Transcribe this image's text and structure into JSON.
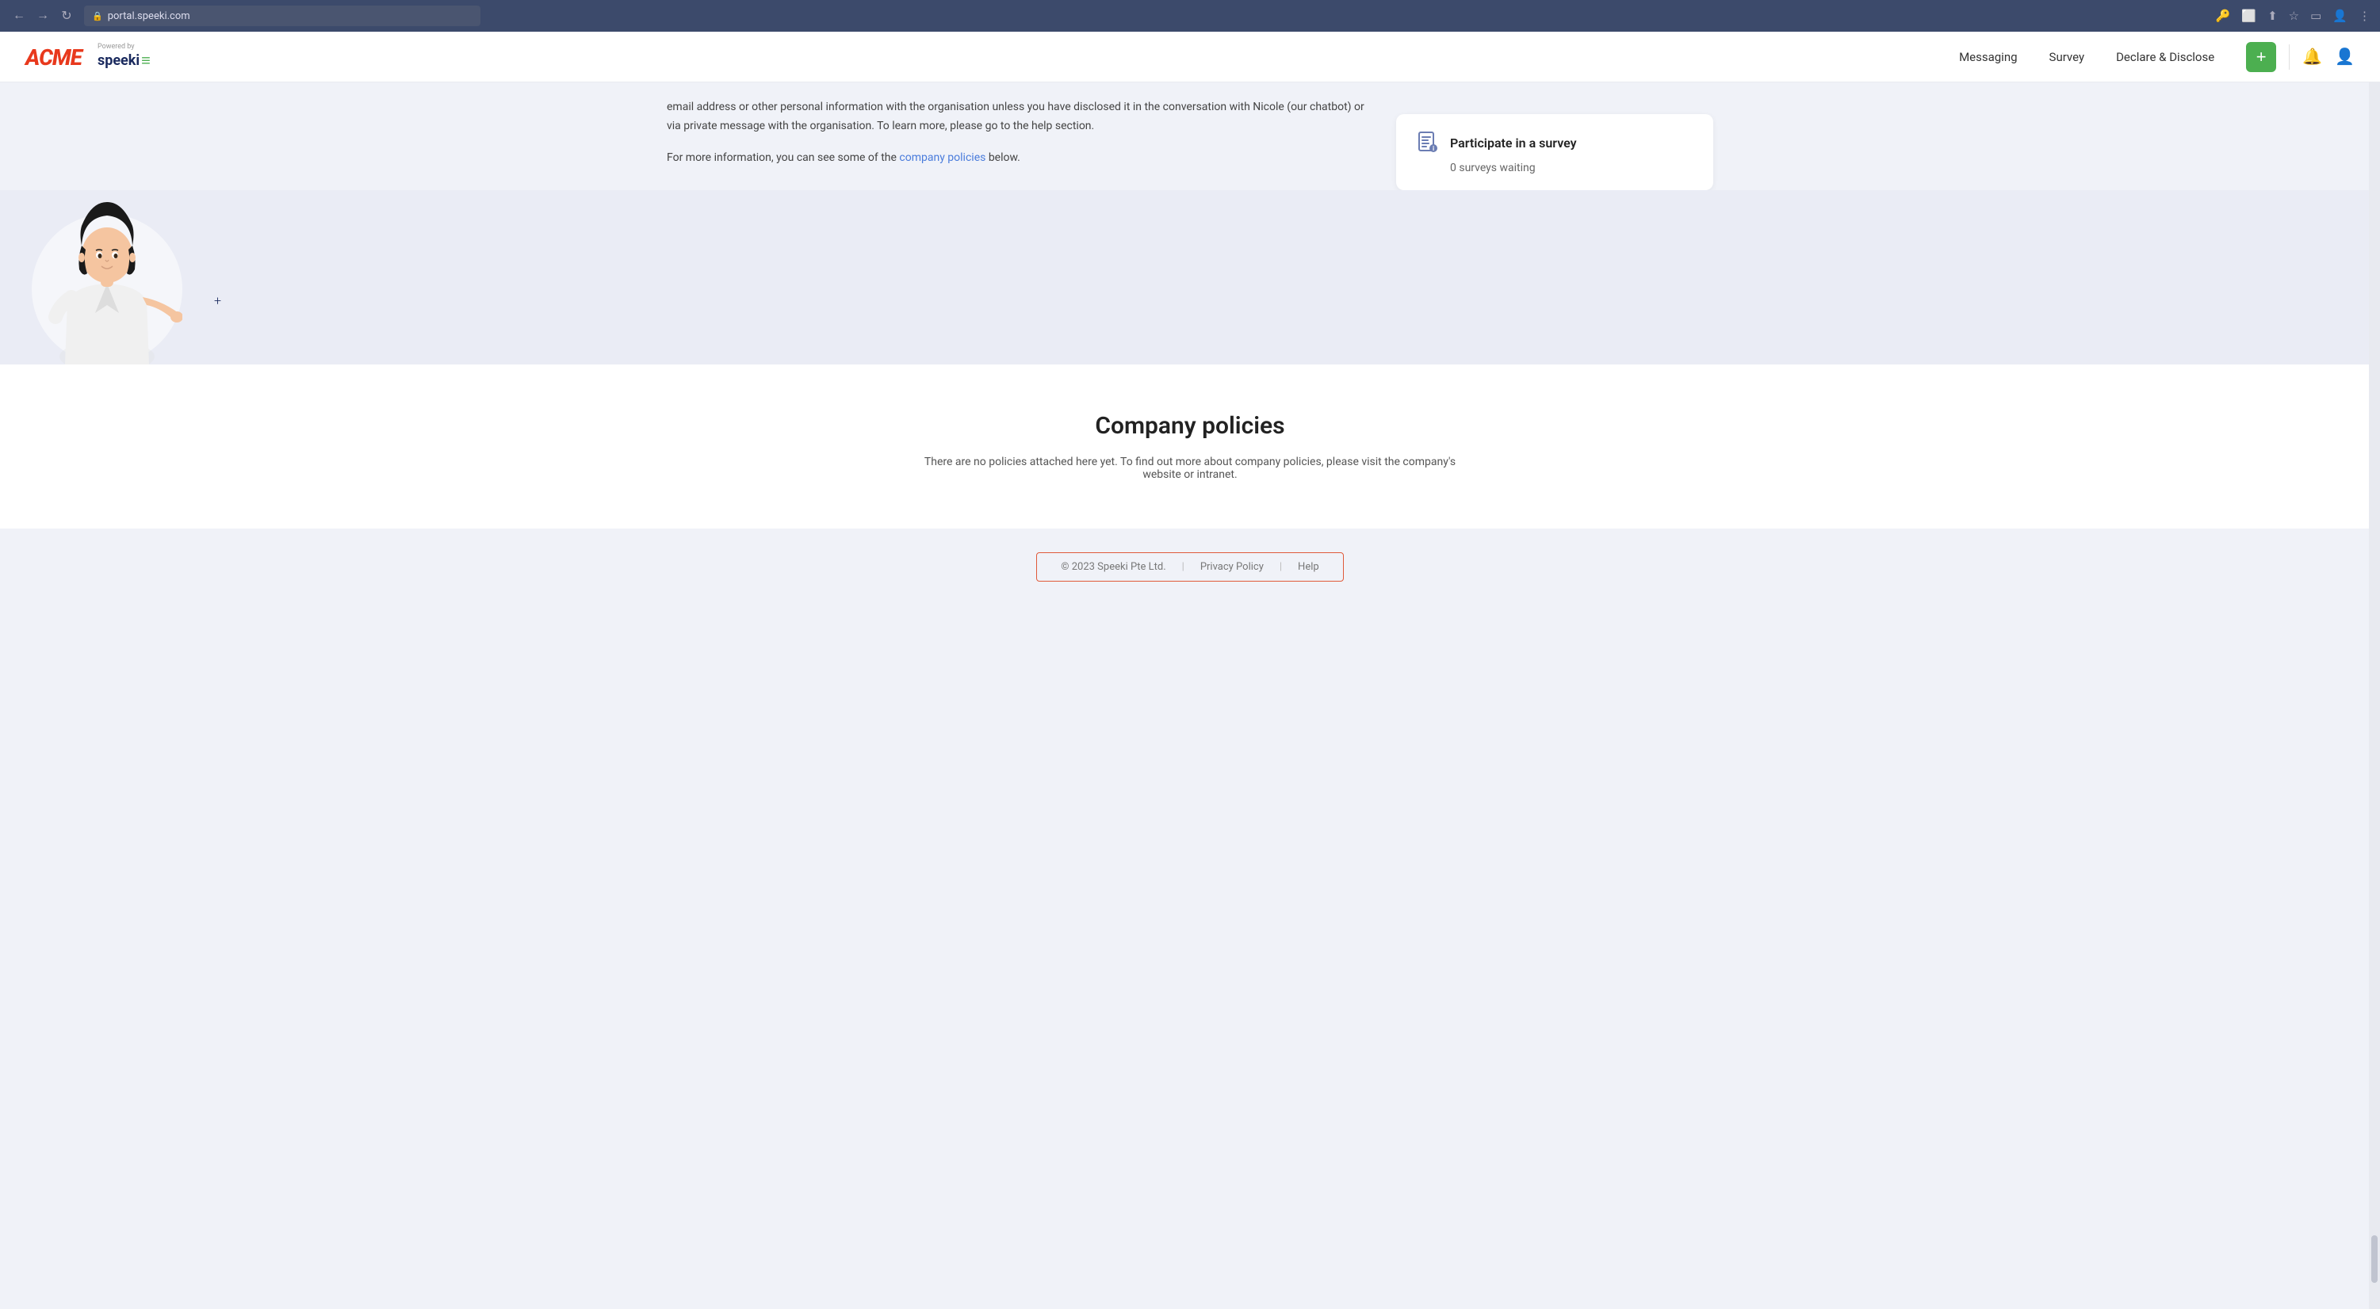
{
  "browser": {
    "url": "portal.speeki.com",
    "back_label": "←",
    "forward_label": "→",
    "refresh_label": "↻"
  },
  "header": {
    "powered_by": "Powered by",
    "acme_logo": "ACME",
    "speeki_logo": "speeki",
    "nav": {
      "messaging": "Messaging",
      "survey": "Survey",
      "declare_disclose": "Declare & Disclose"
    },
    "plus_btn": "+",
    "bell_icon": "🔔",
    "user_icon": "👤"
  },
  "content": {
    "text1": "email address or other personal information with the organisation unless you have disclosed it in the conversation with Nicole (our chatbot) or via private message with the organisation. To learn more, please go to the help section.",
    "text2_prefix": "For more information, you can see some of the ",
    "text2_link": "company policies",
    "text2_suffix": " below."
  },
  "survey_card": {
    "title": "Participate in a survey",
    "count": "0 surveys waiting"
  },
  "chatbot": {
    "plus1": "+",
    "plus2": "+",
    "plus3": "+"
  },
  "policies": {
    "title": "Company policies",
    "description": "There are no policies attached here yet. To find out more about company policies, please visit the company's website or intranet."
  },
  "footer": {
    "copyright": "© 2023 Speeki Pte Ltd.",
    "separator1": "|",
    "privacy_policy": "Privacy Policy",
    "separator2": "|",
    "help": "Help"
  }
}
